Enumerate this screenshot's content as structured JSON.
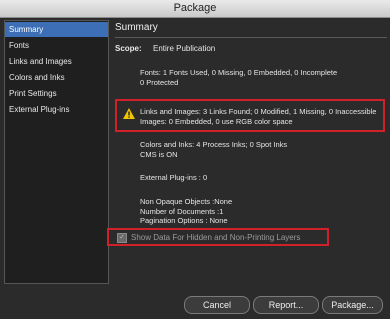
{
  "window": {
    "title": "Package"
  },
  "sidebar": {
    "items": [
      {
        "label": "Summary"
      },
      {
        "label": "Fonts"
      },
      {
        "label": "Links and Images"
      },
      {
        "label": "Colors and Inks"
      },
      {
        "label": "Print Settings"
      },
      {
        "label": "External Plug-ins"
      }
    ]
  },
  "summary": {
    "heading": "Summary",
    "scope_label": "Scope:",
    "scope_value": "Entire Publication",
    "fonts": "Fonts: 1 Fonts Used, 0 Missing, 0 Embedded, 0 Incomplete\n0 Protected",
    "links": "Links and Images: 3 Links Found; 0 Modified, 1 Missing, 0 Inaccessible\nImages: 0 Embedded, 0 use RGB color space",
    "colors": "Colors and Inks: 4 Process Inks; 0 Spot Inks\nCMS is ON",
    "plugins": "External Plug-ins : 0",
    "other": "Non Opaque Objects :None\nNumber of Documents :1\nPagination Options : None"
  },
  "options": {
    "show_hidden_label": "Show Data For Hidden and Non-Printing Layers",
    "show_hidden_checked": true
  },
  "buttons": {
    "cancel": "Cancel",
    "report": "Report...",
    "package": "Package..."
  },
  "colors": {
    "highlight": "#d0202a",
    "selection": "#3d6fb6"
  }
}
